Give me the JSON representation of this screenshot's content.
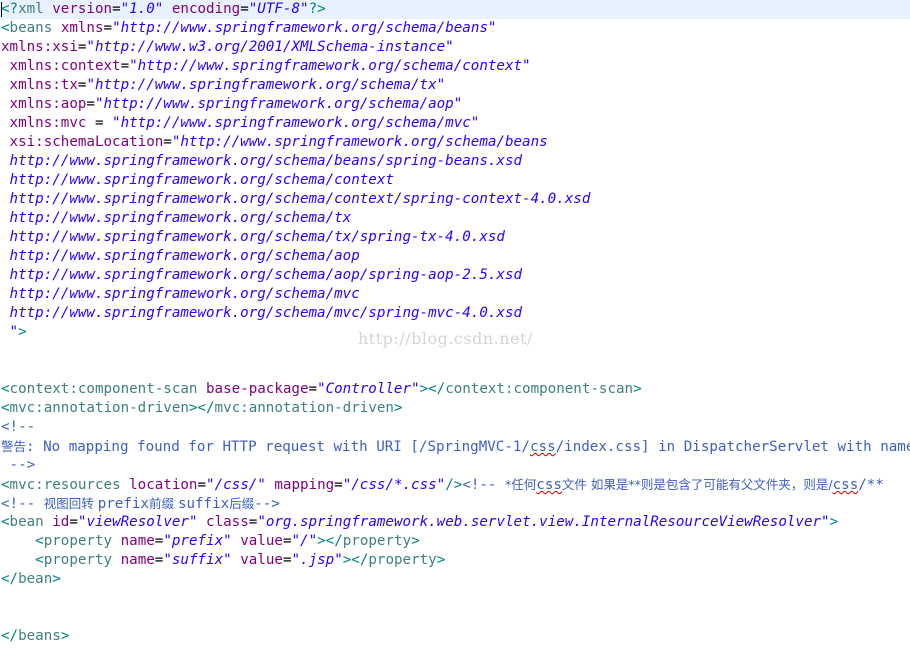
{
  "editor": {
    "lines": [
      {
        "tokens": [
          [
            "bracket",
            "<?"
          ],
          [
            "tag",
            "xml"
          ],
          [
            "text",
            " "
          ],
          [
            "attr",
            "version"
          ],
          [
            "text",
            "="
          ],
          [
            "val",
            "\"1.0\""
          ],
          [
            "text",
            " "
          ],
          [
            "attr",
            "encoding"
          ],
          [
            "text",
            "="
          ],
          [
            "val",
            "\"UTF-8\""
          ],
          [
            "bracket",
            "?>"
          ]
        ]
      },
      {
        "tokens": [
          [
            "bracket",
            "<"
          ],
          [
            "tag",
            "beans"
          ],
          [
            "text",
            " "
          ],
          [
            "attr",
            "xmlns"
          ],
          [
            "text",
            "="
          ],
          [
            "val",
            "\"http://www.springframework.org/schema/beans\""
          ]
        ]
      },
      {
        "tokens": [
          [
            "attr",
            "xmlns:xsi"
          ],
          [
            "text",
            "="
          ],
          [
            "val",
            "\"http://www.w3.org/2001/XMLSchema-instance\""
          ]
        ]
      },
      {
        "tokens": [
          [
            "text",
            " "
          ],
          [
            "attr",
            "xmlns:context"
          ],
          [
            "text",
            "="
          ],
          [
            "val",
            "\"http://www.springframework.org/schema/context\""
          ]
        ]
      },
      {
        "tokens": [
          [
            "text",
            " "
          ],
          [
            "attr",
            "xmlns:tx"
          ],
          [
            "text",
            "="
          ],
          [
            "val",
            "\"http://www.springframework.org/schema/tx\""
          ]
        ]
      },
      {
        "tokens": [
          [
            "text",
            " "
          ],
          [
            "attr",
            "xmlns:aop"
          ],
          [
            "text",
            "="
          ],
          [
            "val",
            "\"http://www.springframework.org/schema/aop\""
          ]
        ]
      },
      {
        "tokens": [
          [
            "text",
            " "
          ],
          [
            "attr",
            "xmlns:mvc"
          ],
          [
            "text",
            " = "
          ],
          [
            "val",
            "\"http://www.springframework.org/schema/mvc\""
          ]
        ]
      },
      {
        "tokens": [
          [
            "text",
            " "
          ],
          [
            "attr",
            "xsi:schemaLocation"
          ],
          [
            "text",
            "="
          ],
          [
            "val",
            "\"http://www.springframework.org/schema/beans"
          ]
        ]
      },
      {
        "tokens": [
          [
            "text",
            " "
          ],
          [
            "val",
            "http://www.springframework.org/schema/beans/spring-beans.xsd"
          ]
        ]
      },
      {
        "tokens": [
          [
            "text",
            " "
          ],
          [
            "val",
            "http://www.springframework.org/schema/context"
          ]
        ]
      },
      {
        "tokens": [
          [
            "text",
            " "
          ],
          [
            "val",
            "http://www.springframework.org/schema/context/spring-context-4.0.xsd"
          ]
        ]
      },
      {
        "tokens": [
          [
            "text",
            " "
          ],
          [
            "val",
            "http://www.springframework.org/schema/tx"
          ]
        ]
      },
      {
        "tokens": [
          [
            "text",
            " "
          ],
          [
            "val",
            "http://www.springframework.org/schema/tx/spring-tx-4.0.xsd"
          ]
        ]
      },
      {
        "tokens": [
          [
            "text",
            " "
          ],
          [
            "val",
            "http://www.springframework.org/schema/aop"
          ]
        ]
      },
      {
        "tokens": [
          [
            "text",
            " "
          ],
          [
            "val",
            "http://www.springframework.org/schema/aop/spring-aop-2.5.xsd"
          ]
        ]
      },
      {
        "tokens": [
          [
            "text",
            " "
          ],
          [
            "val",
            "http://www.springframework.org/schema/mvc"
          ]
        ]
      },
      {
        "tokens": [
          [
            "text",
            " "
          ],
          [
            "val",
            "http://www.springframework.org/schema/mvc/spring-mvc-4.0.xsd"
          ]
        ]
      },
      {
        "tokens": [
          [
            "text",
            " "
          ],
          [
            "val",
            "\""
          ],
          [
            "bracket",
            ">"
          ]
        ]
      },
      {
        "tokens": []
      },
      {
        "tokens": []
      },
      {
        "tokens": [
          [
            "bracket",
            "<"
          ],
          [
            "tag",
            "context:component-scan"
          ],
          [
            "text",
            " "
          ],
          [
            "attr",
            "base-package"
          ],
          [
            "text",
            "="
          ],
          [
            "val",
            "\"Controller\""
          ],
          [
            "bracket",
            "></"
          ],
          [
            "tag",
            "context:component-scan"
          ],
          [
            "bracket",
            ">"
          ]
        ]
      },
      {
        "tokens": [
          [
            "bracket",
            "<"
          ],
          [
            "tag",
            "mvc:annotation-driven"
          ],
          [
            "bracket",
            "></"
          ],
          [
            "tag",
            "mvc:annotation-driven"
          ],
          [
            "bracket",
            ">"
          ]
        ]
      },
      {
        "tokens": [
          [
            "comment",
            "<!--"
          ]
        ]
      },
      {
        "tokens": [
          [
            "cjk",
            "警告"
          ],
          [
            "comment",
            ": No mapping found for HTTP request with URI [/SpringMVC-1/"
          ],
          [
            "comment-sq",
            "css"
          ],
          [
            "comment",
            "/index.css] in DispatcherServlet with name"
          ]
        ]
      },
      {
        "tokens": [
          [
            "comment",
            " -->"
          ]
        ]
      },
      {
        "tokens": [
          [
            "bracket",
            "<"
          ],
          [
            "tag",
            "mvc:resources"
          ],
          [
            "text",
            " "
          ],
          [
            "attr",
            "location"
          ],
          [
            "text",
            "="
          ],
          [
            "val",
            "\"/css/\""
          ],
          [
            "text",
            " "
          ],
          [
            "attr",
            "mapping"
          ],
          [
            "text",
            "="
          ],
          [
            "val",
            "\"/css/*.css\""
          ],
          [
            "bracket",
            "/>"
          ],
          [
            "comment",
            "<!-- "
          ],
          [
            "cjk",
            "*任何"
          ],
          [
            "comment-sq",
            "css"
          ],
          [
            "cjk",
            "文件 如果是**则是包含了可能有父文件夹，则是/"
          ],
          [
            "comment-sq",
            "css"
          ],
          [
            "comment",
            "/**"
          ]
        ]
      },
      {
        "tokens": [
          [
            "comment",
            "<!-- "
          ],
          [
            "cjk",
            "视图回转 "
          ],
          [
            "comment",
            "prefix"
          ],
          [
            "cjk",
            "前缀 "
          ],
          [
            "comment",
            "suffix"
          ],
          [
            "cjk",
            "后缀"
          ],
          [
            "comment",
            "-->"
          ]
        ]
      },
      {
        "tokens": [
          [
            "bracket",
            "<"
          ],
          [
            "tag",
            "bean"
          ],
          [
            "text",
            " "
          ],
          [
            "attr",
            "id"
          ],
          [
            "text",
            "="
          ],
          [
            "val",
            "\"viewResolver\""
          ],
          [
            "text",
            " "
          ],
          [
            "attr",
            "class"
          ],
          [
            "text",
            "="
          ],
          [
            "val",
            "\"org.springframework.web.servlet.view.InternalResourceViewResolver\""
          ],
          [
            "bracket",
            ">"
          ]
        ]
      },
      {
        "tokens": [
          [
            "text",
            "    "
          ],
          [
            "bracket",
            "<"
          ],
          [
            "tag",
            "property"
          ],
          [
            "text",
            " "
          ],
          [
            "attr",
            "name"
          ],
          [
            "text",
            "="
          ],
          [
            "val",
            "\"prefix\""
          ],
          [
            "text",
            " "
          ],
          [
            "attr",
            "value"
          ],
          [
            "text",
            "="
          ],
          [
            "val",
            "\"/\""
          ],
          [
            "bracket",
            "></"
          ],
          [
            "tag",
            "property"
          ],
          [
            "bracket",
            ">"
          ]
        ]
      },
      {
        "tokens": [
          [
            "text",
            "    "
          ],
          [
            "bracket",
            "<"
          ],
          [
            "tag",
            "property"
          ],
          [
            "text",
            " "
          ],
          [
            "attr",
            "name"
          ],
          [
            "text",
            "="
          ],
          [
            "val",
            "\"suffix\""
          ],
          [
            "text",
            " "
          ],
          [
            "attr",
            "value"
          ],
          [
            "text",
            "="
          ],
          [
            "val",
            "\".jsp\""
          ],
          [
            "bracket",
            "></"
          ],
          [
            "tag",
            "property"
          ],
          [
            "bracket",
            ">"
          ]
        ]
      },
      {
        "tokens": [
          [
            "bracket",
            "</"
          ],
          [
            "tag",
            "bean"
          ],
          [
            "bracket",
            ">"
          ]
        ]
      },
      {
        "tokens": []
      },
      {
        "tokens": []
      },
      {
        "tokens": [
          [
            "bracket",
            "</"
          ],
          [
            "tag",
            "beans"
          ],
          [
            "bracket",
            ">"
          ]
        ]
      }
    ]
  },
  "watermark": "http://blog.csdn.net/"
}
